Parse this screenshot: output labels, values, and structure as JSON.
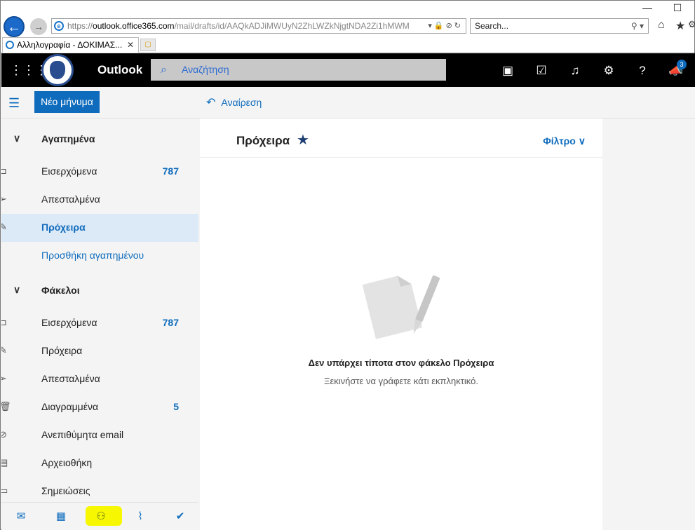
{
  "browser": {
    "url_scheme": "https://",
    "url_host": "outlook.office365.com",
    "url_path": "/mail/drafts/id/AAQkADJiMWUyN2ZhLWZkNjgtNDA2Zi1hMWM",
    "search_placeholder": "Search...",
    "tab_title": "Αλληλογραφία - ΔΟΚΙΜΑΣ..."
  },
  "header": {
    "app_name": "Outlook",
    "search_placeholder": "Αναζήτηση",
    "notification_count": "3"
  },
  "toolbar": {
    "new_message_label": "Νέο μήνυμα",
    "undo_label": "Αναίρεση"
  },
  "sidebar": {
    "favorites_title": "Αγαπημένα",
    "favorites": [
      {
        "label": "Εισερχόμενα",
        "count": "787",
        "icon": "inbox-icon"
      },
      {
        "label": "Απεσταλμένα",
        "count": "",
        "icon": "send-icon"
      },
      {
        "label": "Πρόχειρα",
        "count": "",
        "icon": "pencil-icon"
      },
      {
        "label": "Προσθήκη αγαπημένου",
        "count": ""
      }
    ],
    "folders_title": "Φάκελοι",
    "folders": [
      {
        "label": "Εισερχόμενα",
        "count": "787",
        "icon": "inbox-icon"
      },
      {
        "label": "Πρόχειρα",
        "count": "",
        "icon": "pencil-icon"
      },
      {
        "label": "Απεσταλμένα",
        "count": "",
        "icon": "send-icon"
      },
      {
        "label": "Διαγραμμένα",
        "count": "5",
        "icon": "trash-icon"
      },
      {
        "label": "Ανεπιθύμητα email",
        "count": "",
        "icon": "block-icon"
      },
      {
        "label": "Αρχειοθήκη",
        "count": "",
        "icon": "archive-icon"
      },
      {
        "label": "Σημειώσεις",
        "count": "",
        "icon": "note-icon"
      }
    ]
  },
  "main": {
    "folder_title": "Πρόχειρα",
    "filter_label": "Φίλτρο",
    "empty_title": "Δεν υπάρχει τίποτα στον φάκελο Πρόχειρα",
    "empty_subtitle": "Ξεκινήστε να γράφετε κάτι εκπληκτικό."
  },
  "colors": {
    "accent": "#0f6cbd",
    "header_bg": "#000000",
    "selected_bg": "#dce9f7",
    "highlight": "#f6f700"
  }
}
